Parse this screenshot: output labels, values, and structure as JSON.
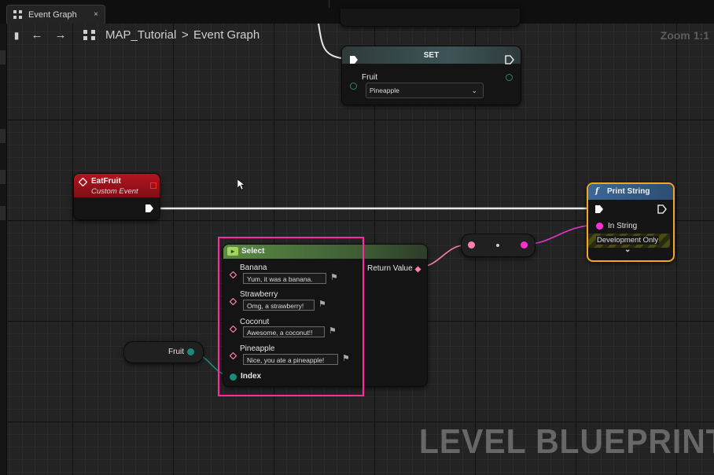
{
  "tab": {
    "label": "Event Graph",
    "close": "×"
  },
  "toolbar": {
    "breadcrumb_root": "MAP_Tutorial",
    "breadcrumb_sep": ">",
    "breadcrumb_current": "Event Graph",
    "zoom": "Zoom 1:1"
  },
  "nodes": {
    "set": {
      "title": "SET",
      "var_label": "Fruit",
      "value": "Pineapple"
    },
    "event": {
      "title": "EatFruit",
      "subtitle": "Custom Event"
    },
    "print": {
      "title": "Print String",
      "in_string": "In String",
      "footer": "Development Only"
    },
    "select": {
      "title": "Select",
      "return_label": "Return Value",
      "index_label": "Index",
      "options": [
        {
          "label": "Banana",
          "value": "Yum, it was a banana."
        },
        {
          "label": "Strawberry",
          "value": "Omg, a strawberry!"
        },
        {
          "label": "Coconut",
          "value": "Awesome, a coconut!!"
        },
        {
          "label": "Pineapple",
          "value": "Nice, you ate a pineapple!"
        }
      ]
    },
    "fruit_getter": {
      "label": "Fruit"
    }
  },
  "colors": {
    "exec": "#ffffff",
    "string_pin": "#ff2fd0",
    "enum_pin": "#1a8a7a",
    "wildcard_pin": "#ff7fb0",
    "highlight": "#ff2aa0",
    "print_border": "#f5a623"
  },
  "watermark": "LEVEL BLUEPRINT"
}
